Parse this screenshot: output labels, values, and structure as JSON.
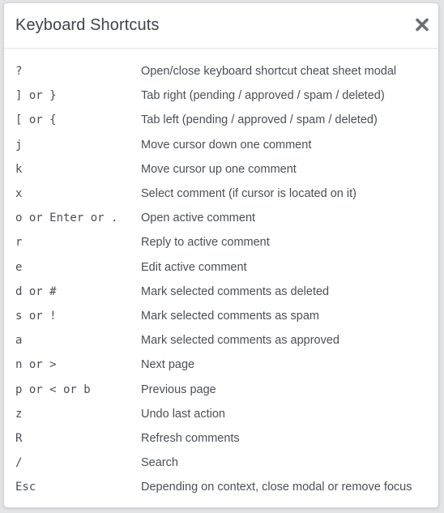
{
  "modal": {
    "title": "Keyboard Shortcuts",
    "close_icon": "close-x-icon",
    "shortcuts": [
      {
        "keys": "?",
        "description": "Open/close keyboard shortcut cheat sheet modal"
      },
      {
        "keys": "] or }",
        "description": "Tab right (pending / approved / spam / deleted)"
      },
      {
        "keys": "[ or {",
        "description": "Tab left (pending / approved / spam / deleted)"
      },
      {
        "keys": "j",
        "description": "Move cursor down one comment"
      },
      {
        "keys": "k",
        "description": "Move cursor up one comment"
      },
      {
        "keys": "x",
        "description": "Select comment (if cursor is located on it)"
      },
      {
        "keys": "o or Enter or .",
        "description": "Open active comment"
      },
      {
        "keys": "r",
        "description": "Reply to active comment"
      },
      {
        "keys": "e",
        "description": "Edit active comment"
      },
      {
        "keys": "d or #",
        "description": "Mark selected comments as deleted"
      },
      {
        "keys": "s or !",
        "description": "Mark selected comments as spam"
      },
      {
        "keys": "a",
        "description": "Mark selected comments as approved"
      },
      {
        "keys": "n or >",
        "description": "Next page"
      },
      {
        "keys": "p or < or b",
        "description": "Previous page"
      },
      {
        "keys": "z",
        "description": "Undo last action"
      },
      {
        "keys": "R",
        "description": "Refresh comments"
      },
      {
        "keys": "/",
        "description": "Search"
      },
      {
        "keys": "Esc",
        "description": "Depending on context, close modal or remove focus"
      }
    ]
  }
}
